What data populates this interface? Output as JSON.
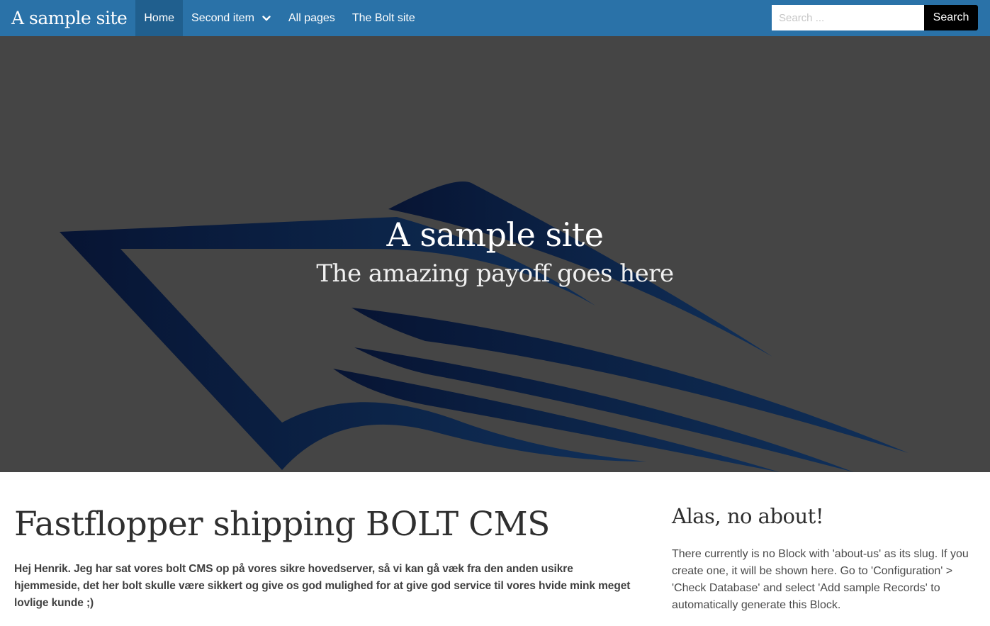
{
  "navbar": {
    "brand": "A sample site",
    "items": [
      {
        "label": "Home",
        "active": true
      },
      {
        "label": "Second item",
        "dropdown": true
      },
      {
        "label": "All pages"
      },
      {
        "label": "The Bolt site"
      }
    ],
    "search": {
      "placeholder": "Search ...",
      "button_label": "Search"
    },
    "icons": {
      "dropdown": "chevron-down-icon"
    }
  },
  "hero": {
    "title": "A sample site",
    "subtitle": "The amazing payoff goes here"
  },
  "main": {
    "title": "Fastflopper shipping BOLT CMS",
    "body": "Hej Henrik. Jeg har sat vores bolt CMS op på vores sikre hovedserver, så vi kan gå væk fra den anden usikre hjemmeside, det her bolt skulle være sikkert og give os god mulighed for at give god service til vores hvide mink meget lovlige kunde ;)"
  },
  "aside": {
    "title": "Alas, no about!",
    "body": "There currently is no Block with 'about-us' as its slug. If you create one, it will be shown here. Go to 'Configuration' > 'Check Database' and select 'Add sample Records' to automatically generate this Block."
  },
  "colors": {
    "navbar": "#2a72a8",
    "nav_active": "#205f8e",
    "hero_bg": "#454545",
    "logo": "#0a1a3c",
    "search_button": "#000000"
  }
}
